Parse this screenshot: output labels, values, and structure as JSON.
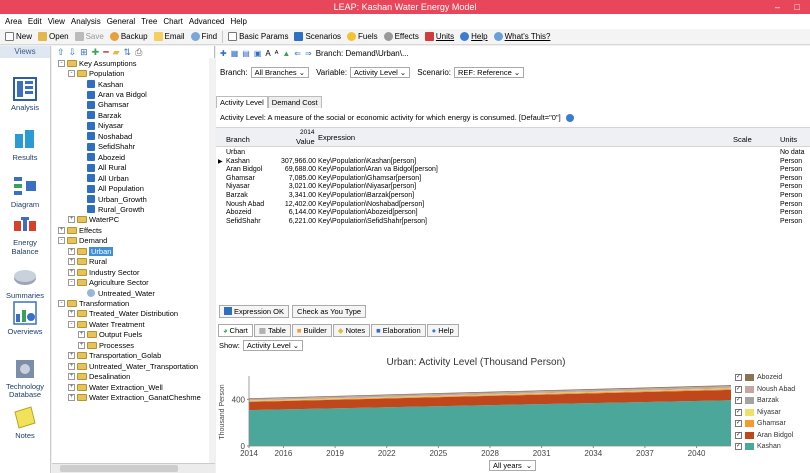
{
  "window": {
    "title": "LEAP: Kashan Water Energy Model",
    "controls": "– □"
  },
  "menu": [
    "Area",
    "Edit",
    "View",
    "Analysis",
    "General",
    "Tree",
    "Chart",
    "Advanced",
    "Help"
  ],
  "toolbar": {
    "new": "New",
    "open": "Open",
    "save": "Save",
    "backup": "Backup",
    "email": "Email",
    "find": "Find",
    "basic_params": "Basic Params",
    "scenarios": "Scenarios",
    "fuels": "Fuels",
    "effects": "Effects",
    "units": "Units",
    "help": "Help",
    "whats_this": "What's This?"
  },
  "views": {
    "header": "Views",
    "items": [
      {
        "label": "Analysis",
        "icon": "analysis-icon"
      },
      {
        "label": "Results",
        "icon": "results-icon"
      },
      {
        "label": "Diagram",
        "icon": "diagram-icon"
      },
      {
        "label": "Energy Balance",
        "icon": "energy-balance-icon"
      },
      {
        "label": "Summaries",
        "icon": "summaries-icon"
      },
      {
        "label": "Overviews",
        "icon": "overviews-icon"
      },
      {
        "label": "Technology Database",
        "icon": "technology-database-icon"
      },
      {
        "label": "Notes",
        "icon": "notes-icon"
      }
    ]
  },
  "tree": {
    "nodes": [
      {
        "label": "Key Assumptions",
        "level": 0,
        "kind": "folder",
        "exp": "-"
      },
      {
        "label": "Population",
        "level": 1,
        "kind": "folder",
        "exp": "-"
      },
      {
        "label": "Kashan",
        "level": 2,
        "kind": "item"
      },
      {
        "label": "Aran va Bidgol",
        "level": 2,
        "kind": "item"
      },
      {
        "label": "Ghamsar",
        "level": 2,
        "kind": "item"
      },
      {
        "label": "Barzak",
        "level": 2,
        "kind": "item"
      },
      {
        "label": "Niyasar",
        "level": 2,
        "kind": "item"
      },
      {
        "label": "Noshabad",
        "level": 2,
        "kind": "item"
      },
      {
        "label": "SefidShahr",
        "level": 2,
        "kind": "item"
      },
      {
        "label": "Abozeid",
        "level": 2,
        "kind": "item"
      },
      {
        "label": "All Rural",
        "level": 2,
        "kind": "item"
      },
      {
        "label": "All Urban",
        "level": 2,
        "kind": "item"
      },
      {
        "label": "All Population",
        "level": 2,
        "kind": "item"
      },
      {
        "label": "Urban_Growth",
        "level": 2,
        "kind": "item"
      },
      {
        "label": "Rural_Growth",
        "level": 2,
        "kind": "item"
      },
      {
        "label": "WaterPC",
        "level": 1,
        "kind": "folder",
        "exp": "+"
      },
      {
        "label": "Effects",
        "level": 0,
        "kind": "folder",
        "exp": "+"
      },
      {
        "label": "Demand",
        "level": 0,
        "kind": "folder",
        "exp": "-"
      },
      {
        "label": "Urban",
        "level": 1,
        "kind": "folder",
        "exp": "+",
        "selected": true
      },
      {
        "label": "Rural",
        "level": 1,
        "kind": "folder",
        "exp": "+"
      },
      {
        "label": "Industry Sector",
        "level": 1,
        "kind": "folder",
        "exp": "+"
      },
      {
        "label": "Agriculture Sector",
        "level": 1,
        "kind": "folder",
        "exp": "-"
      },
      {
        "label": "Untreated_Water",
        "level": 2,
        "kind": "tech"
      },
      {
        "label": "Transformation",
        "level": 0,
        "kind": "folder",
        "exp": "-"
      },
      {
        "label": "Treated_Water Distribution",
        "level": 1,
        "kind": "folder",
        "exp": "+"
      },
      {
        "label": "Water Treatment",
        "level": 1,
        "kind": "folder",
        "exp": "-"
      },
      {
        "label": "Output Fuels",
        "level": 2,
        "kind": "folder",
        "exp": "+"
      },
      {
        "label": "Processes",
        "level": 2,
        "kind": "folder",
        "exp": "+"
      },
      {
        "label": "Transportation_Golab",
        "level": 1,
        "kind": "folder",
        "exp": "+"
      },
      {
        "label": "Untreated_Water_Transportation",
        "level": 1,
        "kind": "folder",
        "exp": "+"
      },
      {
        "label": "Desalination",
        "level": 1,
        "kind": "folder",
        "exp": "+"
      },
      {
        "label": "Water Extraction_Well",
        "level": 1,
        "kind": "folder",
        "exp": "+"
      },
      {
        "label": "Water Extraction_GanatCheshme",
        "level": 1,
        "kind": "folder",
        "exp": "+"
      }
    ]
  },
  "selectors": {
    "branch_label": "Branch:",
    "branch_value": "All Branches",
    "variable_label": "Variable:",
    "variable_value": "Activity Level",
    "scenario_label": "Scenario:",
    "scenario_value": "REF: Reference"
  },
  "breadcrumb": "Branch: Demand\\Urban\\...",
  "tabs_top": [
    "Activity Level",
    "Demand Cost"
  ],
  "description": "Activity Level: A measure of the social or economic activity for which energy is consumed. [Default=\"0\"]",
  "table": {
    "headers": {
      "branch": "Branch",
      "value_year": "2014",
      "value": "Value",
      "expression": "Expression",
      "scale": "Scale",
      "units": "Units"
    },
    "rows": [
      {
        "branch": "Urban",
        "value": "",
        "expression": "",
        "scale": "",
        "units": "No data"
      },
      {
        "branch": "Kashan",
        "value": "307,966.00",
        "expression": "Key\\Population\\Kashan[person]",
        "scale": "",
        "units": "Person",
        "current": true
      },
      {
        "branch": "Aran Bidgol",
        "value": "69,688.00",
        "expression": "Key\\Population\\Aran va Bidgol[person]",
        "scale": "",
        "units": "Person"
      },
      {
        "branch": "Ghamsar",
        "value": "7,085.00",
        "expression": "Key\\Population\\Ghamsar[person]",
        "scale": "",
        "units": "Person"
      },
      {
        "branch": "Niyasar",
        "value": "3,021.00",
        "expression": "Key\\Population\\Niyasar[person]",
        "scale": "",
        "units": "Person"
      },
      {
        "branch": "Barzak",
        "value": "3,341.00",
        "expression": "Key\\Population\\Barzak[person]",
        "scale": "",
        "units": "Person"
      },
      {
        "branch": "Noush Abad",
        "value": "12,402.00",
        "expression": "Key\\Population\\Noshabad[person]",
        "scale": "",
        "units": "Person"
      },
      {
        "branch": "Abozeid",
        "value": "6,144.00",
        "expression": "Key\\Population\\Abozeid[person]",
        "scale": "",
        "units": "Person"
      },
      {
        "branch": "SefidShahr",
        "value": "6,221.00",
        "expression": "Key\\Population\\SefidShahr[person]",
        "scale": "",
        "units": "Person"
      }
    ]
  },
  "lower": {
    "expression_ok": "Expression OK",
    "check_as_you_type": "Check as You Type",
    "tabs": [
      "Chart",
      "Table",
      "Builder",
      "Notes",
      "Elaboration",
      "Help"
    ],
    "show_label": "Show:",
    "show_value": "Activity Level",
    "years_value": "All years"
  },
  "chart_data": {
    "type": "area",
    "title": "Urban: Activity Level (Thousand Person)",
    "ylabel": "Thousand Person",
    "xlabel": "",
    "x_ticks": [
      2014,
      2016,
      2019,
      2022,
      2025,
      2028,
      2031,
      2034,
      2037,
      2040
    ],
    "x_range": [
      2014,
      2042
    ],
    "y_ticks": [
      0,
      400
    ],
    "ylim": [
      0,
      600
    ],
    "stacked": true,
    "x": [
      2014,
      2042
    ],
    "series": [
      {
        "name": "Kashan",
        "color": "#4aa79a",
        "values": [
          308,
          392
        ]
      },
      {
        "name": "Aran Bidgol",
        "color": "#c0471c",
        "values": [
          70,
          89
        ]
      },
      {
        "name": "Ghamsar",
        "color": "#f39c2b",
        "values": [
          7,
          9
        ]
      },
      {
        "name": "Niyasar",
        "color": "#efe06a",
        "values": [
          3,
          4
        ]
      },
      {
        "name": "Barzak",
        "color": "#a3a3a3",
        "values": [
          3,
          4
        ]
      },
      {
        "name": "Noush Abad",
        "color": "#c6a6a0",
        "values": [
          12,
          16
        ]
      },
      {
        "name": "Abozeid",
        "color": "#8a7455",
        "values": [
          6,
          8
        ]
      }
    ],
    "legend_order": [
      "Abozeid",
      "Noush Abad",
      "Barzak",
      "Niyasar",
      "Ghamsar",
      "Aran Bidgol",
      "Kashan"
    ],
    "legend_position": "right"
  }
}
